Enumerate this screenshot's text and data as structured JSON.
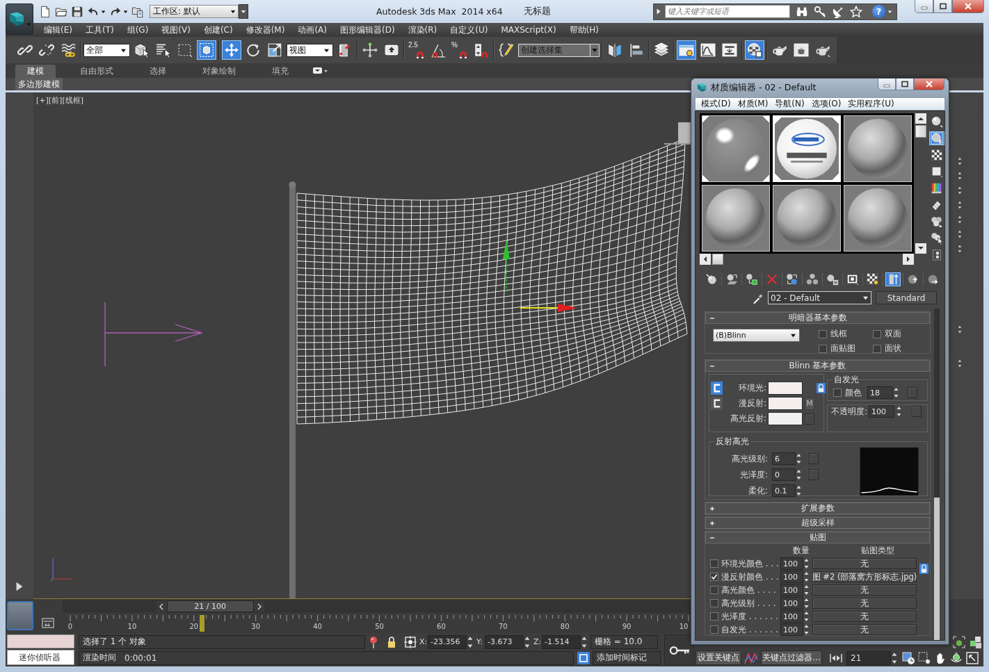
{
  "window": {
    "title": "Autodesk 3ds Max  2014 x64",
    "document": "无标题",
    "workspace": "工作区: 默认",
    "search": {
      "placeholder": "键入关键字或短语"
    },
    "help": "?"
  },
  "menu": [
    "编辑(E)",
    "工具(T)",
    "组(G)",
    "视图(V)",
    "创建(C)",
    "修改器(M)",
    "动画(A)",
    "图形编辑器(D)",
    "渲染(R)",
    "自定义(U)",
    "MAXScript(X)",
    "帮助(H)"
  ],
  "toolbar": {
    "groups": [
      [
        {
          "kind": "button",
          "active": false
        },
        {
          "kind": "button",
          "active": false
        },
        {
          "kind": "button",
          "active": false
        }
      ],
      [
        {
          "kind": "dropdown",
          "value": "全部"
        },
        {
          "kind": "button",
          "active": false
        },
        {
          "kind": "button",
          "active": false
        },
        {
          "kind": "button",
          "active": false
        },
        {
          "kind": "button",
          "active": true
        }
      ],
      [
        {
          "kind": "button",
          "active": true
        },
        {
          "kind": "button",
          "active": false
        },
        {
          "kind": "button",
          "active": false
        },
        {
          "kind": "dropdown",
          "value": "视图"
        },
        {
          "kind": "button",
          "active": false
        }
      ],
      [
        {
          "kind": "button",
          "active": false
        },
        {
          "kind": "button",
          "active": false
        }
      ],
      [
        {
          "kind": "button",
          "active": false,
          "caption": "2.5"
        },
        {
          "kind": "button",
          "active": false
        },
        {
          "kind": "button",
          "active": false,
          "caption": "%"
        },
        {
          "kind": "button",
          "active": false
        }
      ],
      [
        {
          "kind": "button",
          "active": false
        },
        {
          "kind": "combo",
          "placeholder": "创建选择集"
        }
      ],
      [
        {
          "kind": "button",
          "active": false
        },
        {
          "kind": "button",
          "active": false
        }
      ],
      [
        {
          "kind": "button",
          "active": false
        }
      ],
      [
        {
          "kind": "button",
          "active": true
        },
        {
          "kind": "button",
          "active": false
        },
        {
          "kind": "button",
          "active": false
        }
      ],
      [
        {
          "kind": "button",
          "active": true
        }
      ],
      [
        {
          "kind": "button",
          "active": false
        },
        {
          "kind": "button",
          "active": false
        },
        {
          "kind": "button",
          "active": false
        }
      ]
    ]
  },
  "ribbon": {
    "tabs": [
      {
        "label": "建模",
        "selected": true
      },
      {
        "label": "自由形式",
        "selected": false
      },
      {
        "label": "选择",
        "selected": false
      },
      {
        "label": "对象绘制",
        "selected": false
      },
      {
        "label": "填充",
        "selected": false
      }
    ],
    "panel_tab": "多边形建模"
  },
  "viewport": {
    "label": "[+][前][线框]"
  },
  "timeline": {
    "frame": "21 / 100",
    "level": 0.21,
    "ticks": [
      "0",
      "10",
      "20",
      "30",
      "40",
      "50",
      "60",
      "70",
      "80",
      "90",
      "10"
    ]
  },
  "status_bar": {
    "listener": "迷你侦听器",
    "message": "选择了 1 个 对象",
    "render_time": {
      "label": "渲染时间",
      "value": "0:00:01"
    },
    "coords": [
      {
        "axis": "X:",
        "value": "-23.356"
      },
      {
        "axis": "Y:",
        "value": "-3.673"
      },
      {
        "axis": "Z:",
        "value": "-1.514"
      }
    ],
    "grid": "栅格 = 10.0",
    "time_tag": "添加时间标记",
    "set_key": "设置关键点",
    "key_filters": "关键点过滤器...",
    "frame": "21"
  },
  "material_editor": {
    "title": "材质编辑器 - 02 - Default",
    "menu": [
      "模式(D)",
      "材质(M)",
      "导航(N)",
      "选项(O)",
      "实用程序(U)"
    ],
    "slots": [
      {
        "kind": "glossy",
        "selected": false,
        "in_scene": true
      },
      {
        "kind": "textured",
        "selected": true,
        "in_scene": true
      },
      {
        "kind": "matte",
        "selected": false,
        "in_scene": false
      },
      {
        "kind": "matte",
        "selected": false,
        "in_scene": false
      },
      {
        "kind": "matte",
        "selected": false,
        "in_scene": false
      },
      {
        "kind": "matte",
        "selected": false,
        "in_scene": false
      }
    ],
    "side_tools": [
      {
        "active": false
      },
      {
        "active": true
      },
      {
        "active": false
      },
      {
        "active": false
      },
      {
        "active": false
      },
      {
        "active": false
      },
      {
        "active": false
      },
      {
        "active": false
      },
      {
        "active": false
      }
    ],
    "bottom_tools": [
      {
        "active": false
      },
      {
        "active": false
      },
      {
        "active": false
      },
      {
        "active": false
      },
      {
        "active": false
      },
      {
        "active": false
      },
      {
        "active": false
      },
      {
        "active": false
      },
      {
        "active": false
      },
      {
        "active": true
      },
      {
        "active": false
      },
      {
        "active": false
      }
    ],
    "material_name": "02 - Default",
    "material_type": "Standard",
    "rollouts": [
      {
        "kind": "shader",
        "title": "明暗器基本参数",
        "expanded": true,
        "shader": "(B)Blinn",
        "options": [
          {
            "label": "线框",
            "checked": false
          },
          {
            "label": "双面",
            "checked": false
          },
          {
            "label": "面贴图",
            "checked": false
          },
          {
            "label": "面状",
            "checked": false
          }
        ]
      },
      {
        "kind": "basic",
        "title": "Blinn 基本参数",
        "expanded": true,
        "color_modes": [
          {
            "selected": true
          },
          {
            "selected": false
          }
        ],
        "colors": [
          {
            "label": "环境光:",
            "map_button": false
          },
          {
            "label": "漫反射:",
            "map_label": "M"
          },
          {
            "label": "高光反射:",
            "map_button": true
          }
        ],
        "self_illum": {
          "title": "自发光",
          "label": "颜色",
          "checked": false,
          "value": "18"
        },
        "opacity": {
          "label": "不透明度:",
          "value": "100"
        },
        "highlights": {
          "title": "反射高光",
          "params": [
            {
              "label": "高光级别:",
              "value": "6",
              "map_button": true
            },
            {
              "label": "光泽度:",
              "value": "0",
              "map_button": true
            },
            {
              "label": "柔化:",
              "value": "0.1",
              "map_button": false
            }
          ]
        }
      },
      {
        "kind": "plain",
        "title": "扩展参数",
        "expanded": false
      },
      {
        "kind": "plain",
        "title": "超级采样",
        "expanded": false
      },
      {
        "kind": "maps",
        "title": "贴图",
        "expanded": true,
        "columns": [
          "数量",
          "贴图类型"
        ],
        "rows": [
          {
            "label": "环境光颜色 . . .",
            "checked": false,
            "amount": "100",
            "map": "无"
          },
          {
            "label": "漫反射颜色 . . .",
            "checked": true,
            "amount": "100",
            "map": "图 #2 (部落窝方形标志.jpg)"
          },
          {
            "label": "高光颜色 . . . .",
            "checked": false,
            "amount": "100",
            "map": "无"
          },
          {
            "label": "高光级别 . . . .",
            "checked": false,
            "amount": "100",
            "map": "无"
          },
          {
            "label": "光泽度 . . . . . .",
            "checked": false,
            "amount": "100",
            "map": "无"
          },
          {
            "label": "自发光 . . . . . .",
            "checked": false,
            "amount": "100",
            "map": "无"
          }
        ]
      }
    ]
  }
}
